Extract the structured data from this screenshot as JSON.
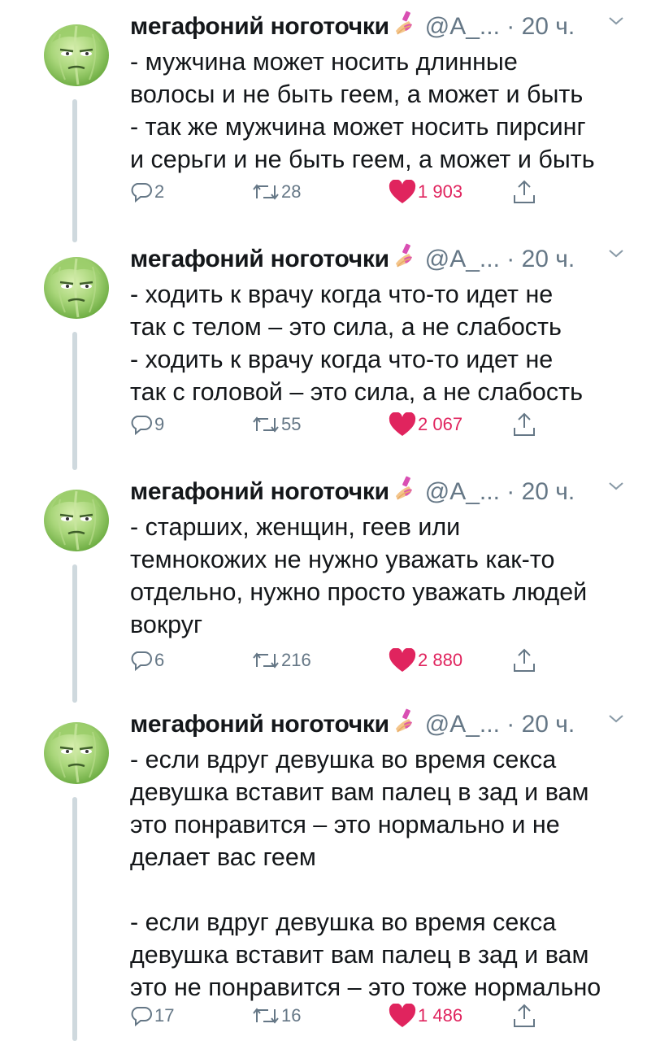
{
  "colors": {
    "text": "#14171a",
    "secondary": "#657786",
    "like": "#e0245e",
    "thread_line": "#cfd9de"
  },
  "icons": {
    "avatar": "cabbage-face-avatar",
    "emoji": "nail-polish-emoji",
    "caret": "chevron-down-icon",
    "reply": "reply-bubble-icon",
    "retweet": "retweet-icon",
    "like": "heart-icon",
    "share": "share-icon"
  },
  "tweets": [
    {
      "name": "мегафоний ноготочки",
      "handle": "@A_...",
      "time": "· 20 ч.",
      "text": "- мужчина может носить длинные\nволосы и не быть геем, а может и быть\n- так же мужчина может носить пирсинг\nи серьги и не быть геем, а может и быть",
      "replies": "2",
      "retweets": "28",
      "likes": "1 903"
    },
    {
      "name": "мегафоний ноготочки",
      "handle": "@A_...",
      "time": "· 20 ч.",
      "text": "- ходить к врачу когда что-то идет не\nтак с телом – это сила, а не слабость\n- ходить к врачу когда что-то идет не\nтак с головой – это сила, а не слабость",
      "replies": "9",
      "retweets": "55",
      "likes": "2 067"
    },
    {
      "name": "мегафоний ноготочки",
      "handle": "@A_...",
      "time": "· 20 ч.",
      "text": "- старших, женщин, геев или\nтемнокожих не нужно уважать как-то\nотдельно, нужно просто уважать людей\nвокруг",
      "replies": "6",
      "retweets": "216",
      "likes": "2 880"
    },
    {
      "name": "мегафоний ноготочки",
      "handle": "@A_...",
      "time": "· 20 ч.",
      "text": "- если вдруг девушка во время секса\nдевушка вставит вам палец в зад и вам\nэто понравится – это нормально и не\nделает вас геем\n\n- если вдруг девушка во время секса\nдевушка вставит вам палец в зад и вам\nэто не понравится – это тоже нормально",
      "replies": "17",
      "retweets": "16",
      "likes": "1 486"
    }
  ]
}
